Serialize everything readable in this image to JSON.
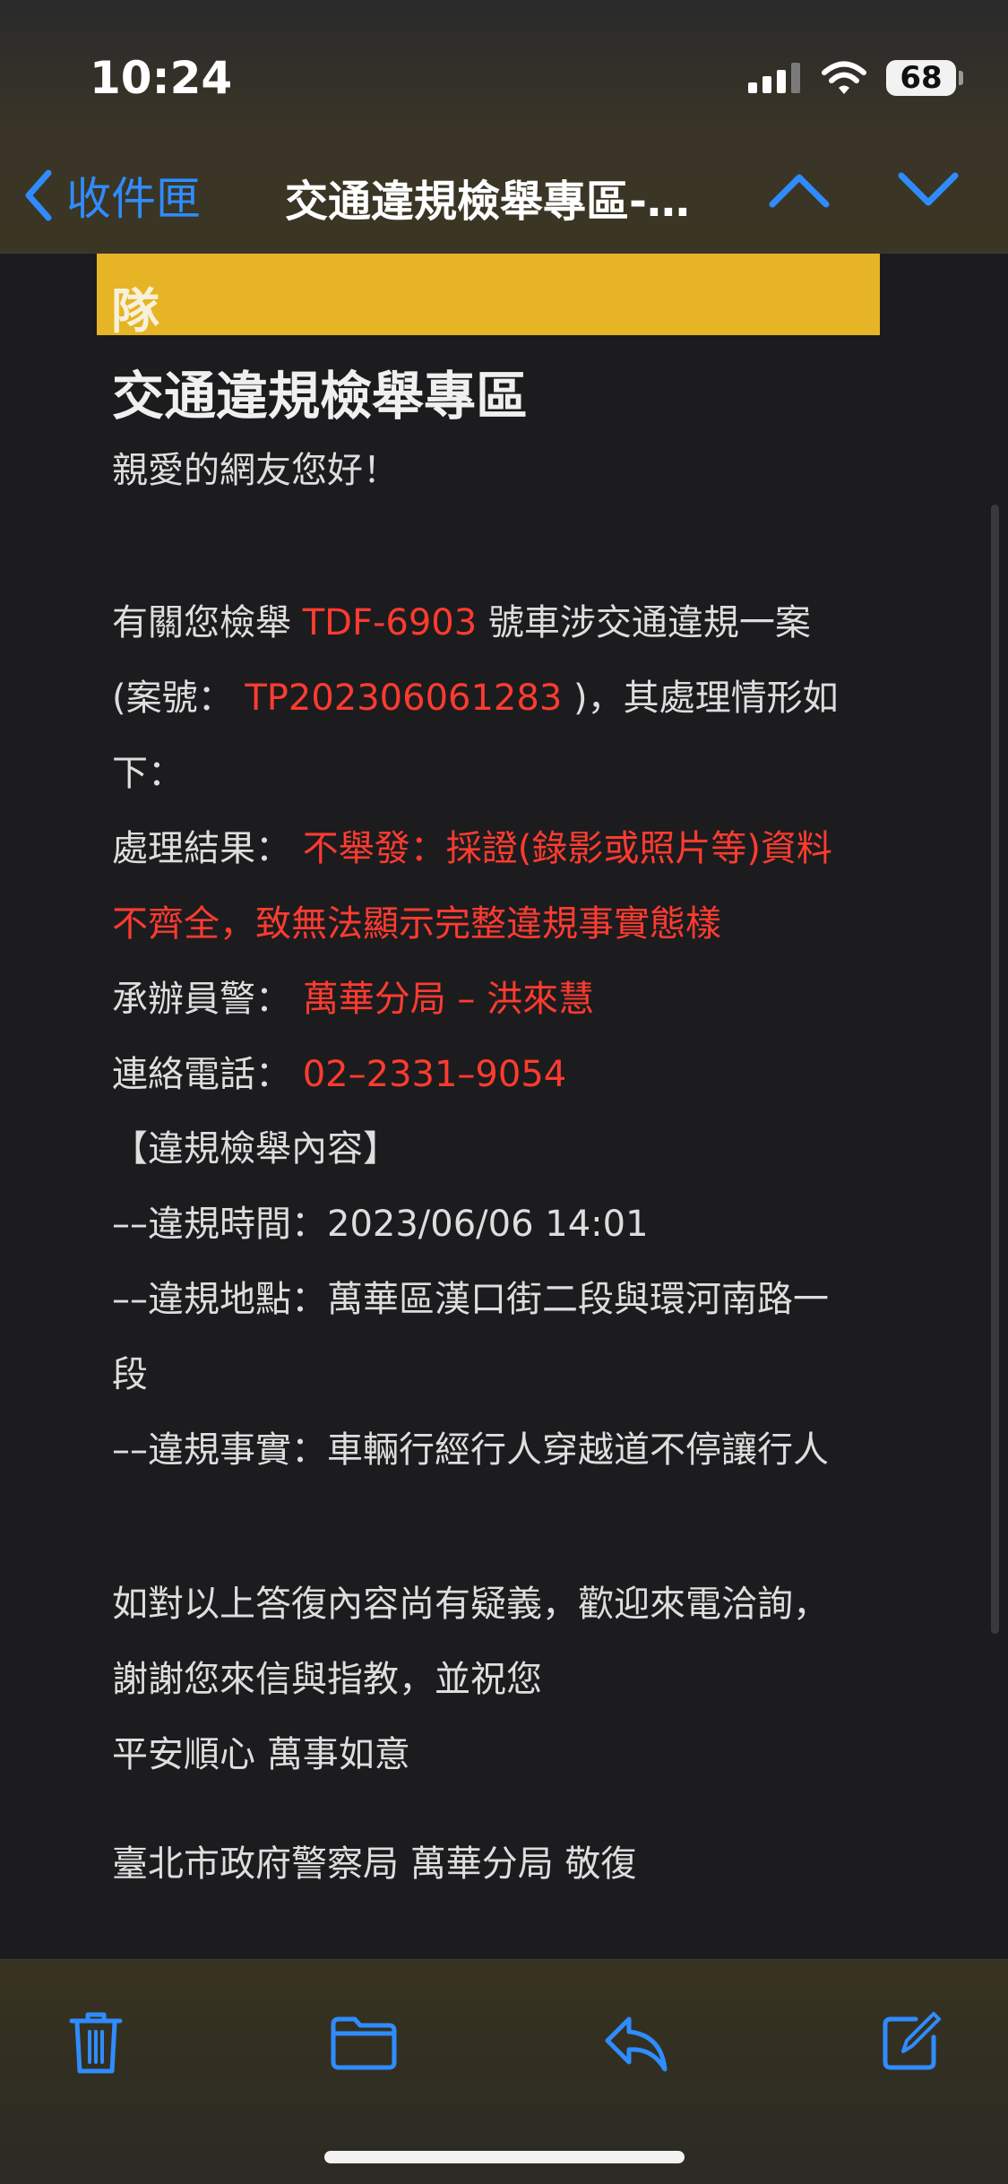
{
  "status": {
    "time": "10:24",
    "battery": "68"
  },
  "nav": {
    "back_label": "收件匣",
    "title": "交通違規檢舉專區-…"
  },
  "email": {
    "banner_char": "隊",
    "heading": "交通違規檢舉專區",
    "greeting": "親愛的網友您好！",
    "p1_a": "有關您檢舉 ",
    "plate": "TDF-6903",
    "p1_b": " 號車涉交通違規一案",
    "p1_c": "(案號： ",
    "case_no": "TP202306061283",
    "p1_d": " )，其處理情形如",
    "p1_e": "下：",
    "result_label": "處理結果： ",
    "result_value_1": "不舉發：採證(錄影或照片等)資料",
    "result_value_2": "不齊全，致無法顯示完整違規事實態樣",
    "officer_label": "承辦員警： ",
    "officer_value": "萬華分局 – 洪來慧",
    "phone_label": "連絡電話： ",
    "phone_value": "02–2331–9054",
    "section_title": "【違規檢舉內容】",
    "time_line": "––違規時間：2023/06/06 14:01",
    "place_line_1": "––違規地點：萬華區漢口街二段與環河南路一",
    "place_line_2": "段",
    "fact_line": "––違規事實：車輛行經行人穿越道不停讓行人",
    "closing_1": "如對以上答復內容尚有疑義，歡迎來電洽詢，",
    "closing_2": "謝謝您來信與指教，並祝您",
    "closing_3": "平安順心 萬事如意",
    "signature": "臺北市政府警察局 萬華分局 敬復"
  },
  "colors": {
    "accent": "#2f8cff",
    "highlight": "#ff3b30",
    "banner": "#e6b424"
  },
  "toolbar": {
    "icons": [
      "trash-icon",
      "folder-icon",
      "reply-icon",
      "compose-icon"
    ]
  }
}
